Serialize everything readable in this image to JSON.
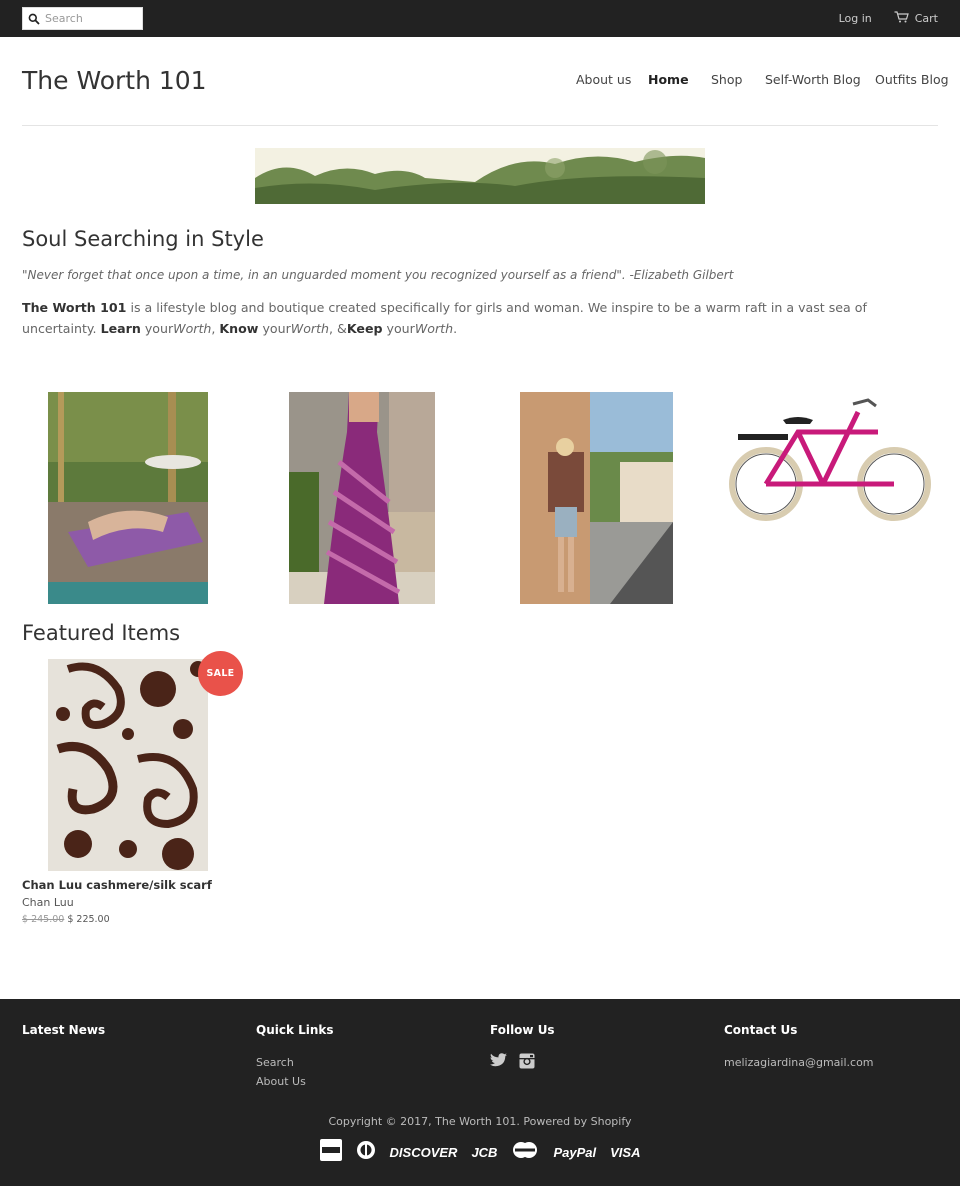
{
  "topbar": {
    "search_placeholder": "Search",
    "login_label": "Log in",
    "cart_label": "Cart"
  },
  "header": {
    "logo": "The Worth 101",
    "nav": [
      {
        "label": "About us",
        "active": false
      },
      {
        "label": "Home",
        "active": true
      },
      {
        "label": "Shop",
        "active": false
      },
      {
        "label": "Self-Worth Blog",
        "active": false
      },
      {
        "label": "Outfits Blog",
        "active": false
      }
    ]
  },
  "main": {
    "title": "Soul Searching in Style",
    "quote": "\"Never forget that once upon a time, in an unguarded moment you recognized yourself as a friend\". -Elizabeth Gilbert",
    "intro": {
      "brand": "The Worth 101",
      "text1": " is a lifestyle blog and boutique created specifically for girls and woman. We inspire to be a warm raft in a vast sea of uncertainty. ",
      "learn": "Learn",
      "your1": " your",
      "worth1": "Worth",
      "sep1": ", ",
      "know": "Know",
      "your2": " your",
      "worth2": "Worth",
      "sep2": ", &",
      "keep": "Keep",
      "your3": " your",
      "worth3": "Worth",
      "end": "."
    }
  },
  "featured": {
    "title": "Featured Items",
    "product": {
      "badge": "SALE",
      "name": "Chan Luu cashmere/silk scarf",
      "vendor": "Chan Luu",
      "old_price": "$ 245.00",
      "price": "$ 225.00"
    }
  },
  "footer": {
    "latest_news": "Latest News",
    "quick_links": "Quick Links",
    "links": [
      "Search",
      "About Us"
    ],
    "follow_us": "Follow Us",
    "contact_us": "Contact Us",
    "email": "melizagiardina@gmail.com",
    "copyright": "Copyright © 2017, The Worth 101. Powered by Shopify",
    "payments": [
      "DISCOVER",
      "JCB",
      "PayPal",
      "VISA"
    ]
  },
  "colors": {
    "topbar": "#222222",
    "sale_badge": "#e9524a",
    "footer": "#222222"
  }
}
